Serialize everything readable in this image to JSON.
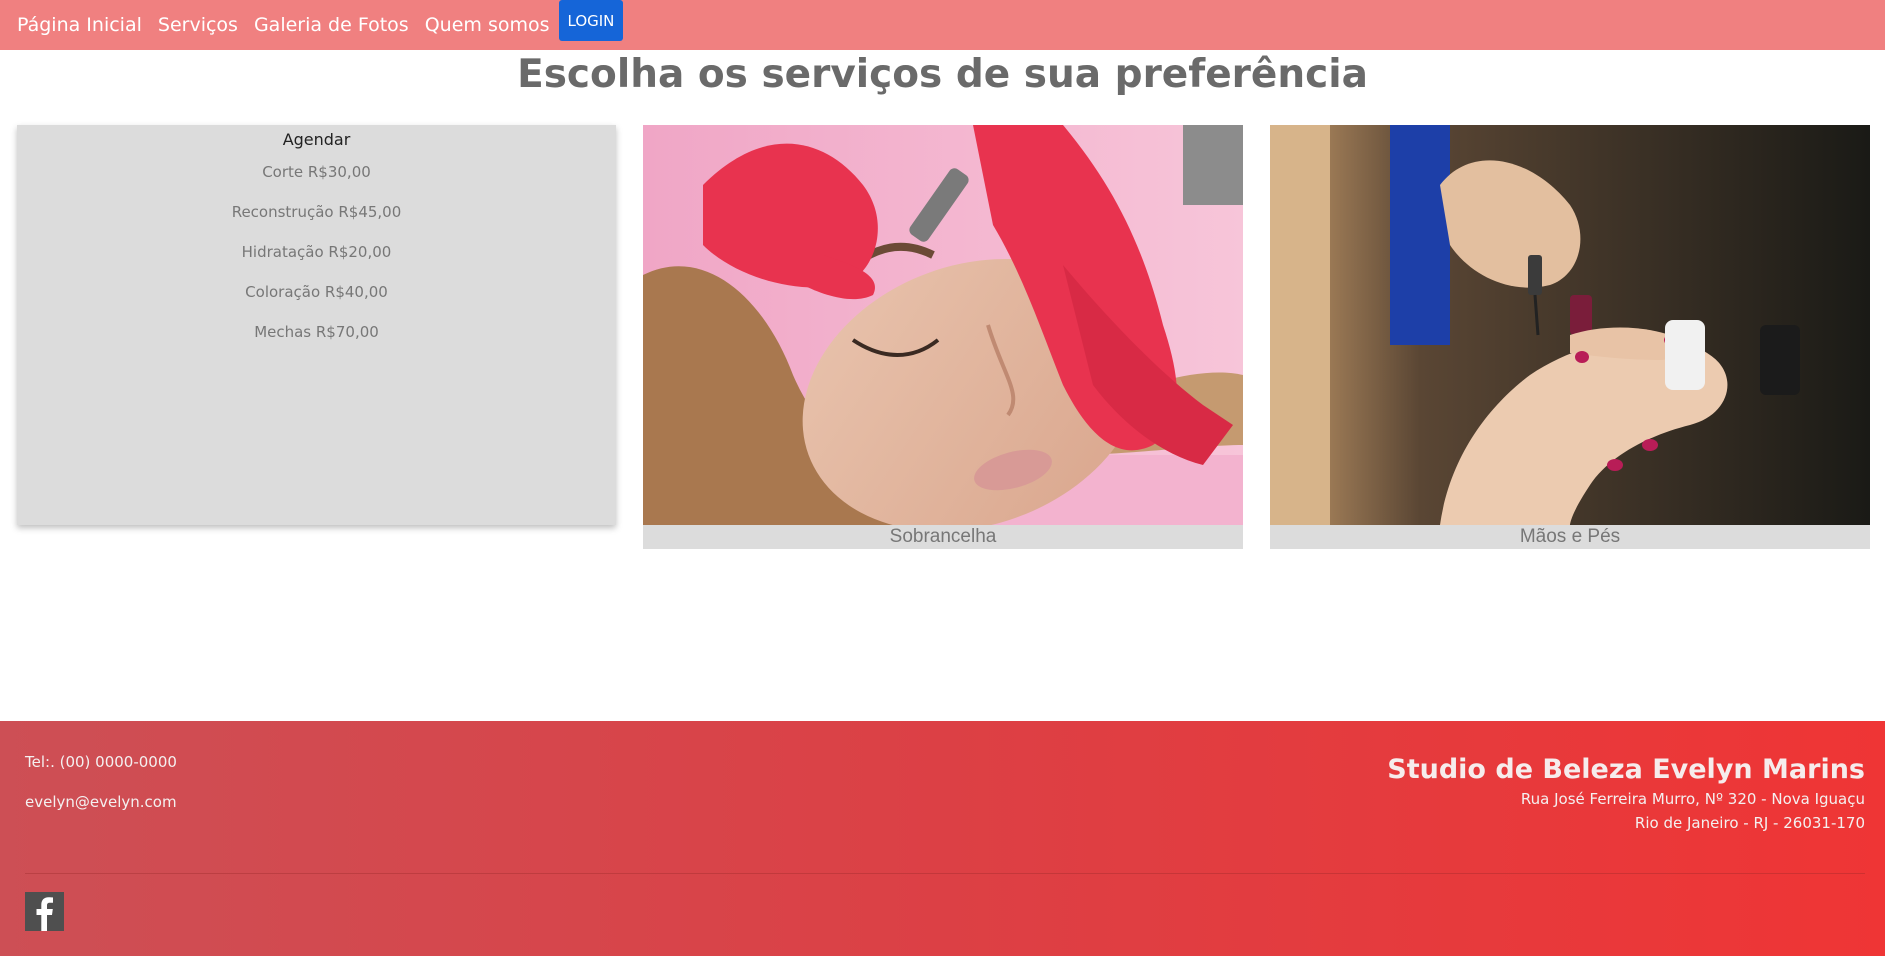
{
  "nav": {
    "items": [
      {
        "label": "Página Inicial"
      },
      {
        "label": "Serviços"
      },
      {
        "label": "Galeria de Fotos"
      },
      {
        "label": "Quem somos"
      }
    ],
    "login_label": "LOGIN"
  },
  "page": {
    "title": "Escolha os serviços de sua preferência"
  },
  "services_card": {
    "heading": "Agendar",
    "items": [
      {
        "label": "Corte R$30,00"
      },
      {
        "label": "Reconstrução R$45,00"
      },
      {
        "label": "Hidratação R$20,00"
      },
      {
        "label": "Coloração R$40,00"
      },
      {
        "label": "Mechas R$70,00"
      }
    ]
  },
  "gallery": {
    "cards": [
      {
        "caption": "Sobrancelha",
        "image": "eyebrow-treatment-photo"
      },
      {
        "caption": "Mãos e Pés",
        "image": "manicure-photo"
      }
    ]
  },
  "footer": {
    "phone": "Tel:. (00) 0000-0000",
    "email": "evelyn@evelyn.com",
    "studio_name": "Studio de Beleza Evelyn Marins",
    "address_line1": "Rua José Ferreira Murro, Nº 320 - Nova Iguaçu",
    "address_line2": "Rio de Janeiro - RJ - 26031-170",
    "social_icon": "facebook-icon"
  },
  "colors": {
    "nav_bg": "#f08080",
    "login_bg": "#1565d8",
    "card_bg": "#dcdcdc",
    "footer_start": "#cd4f55",
    "footer_end": "#ef3535"
  }
}
